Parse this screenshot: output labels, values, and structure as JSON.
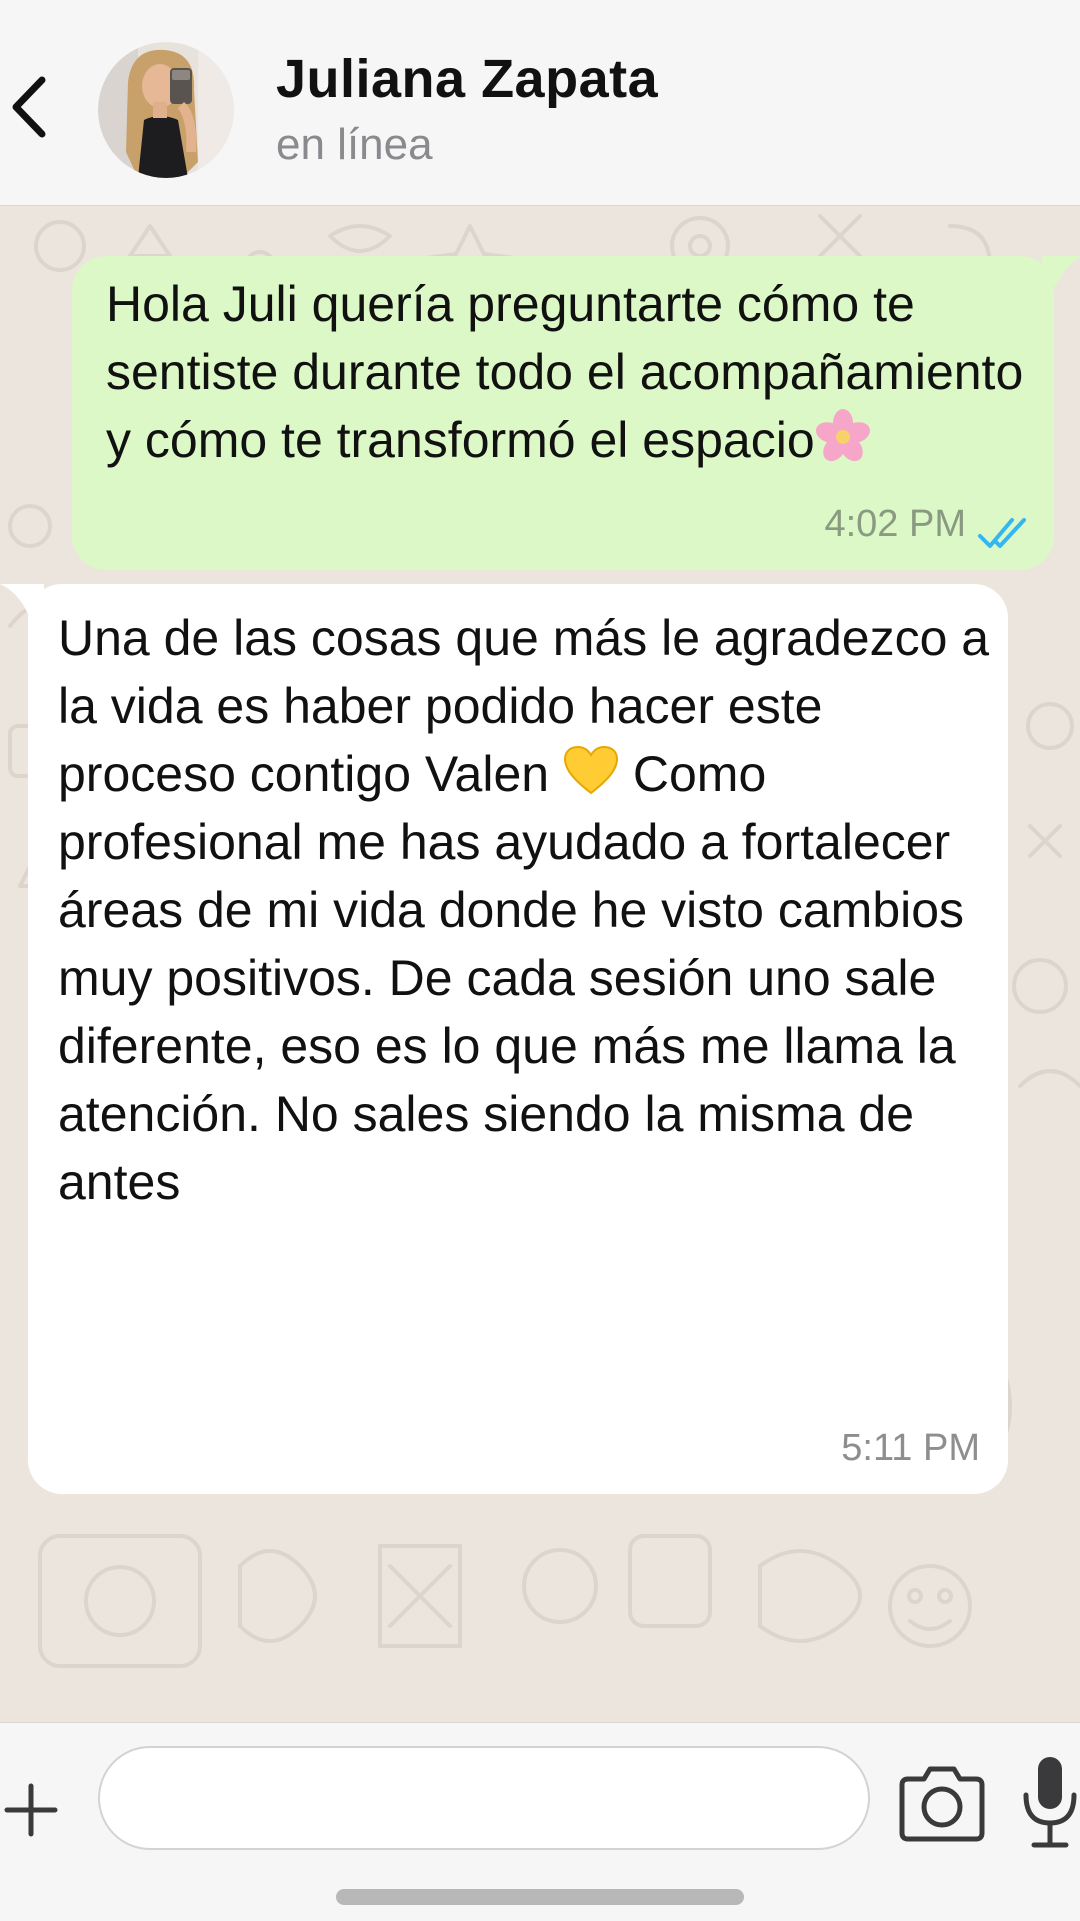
{
  "header": {
    "contact_name": "Juliana Zapata",
    "status": "en línea",
    "back_icon": "chevron-left-icon",
    "avatar_icon": "avatar"
  },
  "messages": [
    {
      "direction": "outgoing",
      "text": "Hola Juli quería preguntarte cómo te sentiste durante todo el acompañamiento y cómo te transformó el espacio",
      "emoji": "cherry-blossom-icon",
      "time": "4:02 PM",
      "status_icon": "double-check-icon"
    },
    {
      "direction": "incoming",
      "text_before_emoji": "Una de las cosas que más le agradezco a la vida es haber podido hacer este proceso contigo Valen",
      "emoji": "yellow-heart-icon",
      "text_after_emoji": "Como profesional me has ayudado a fortalecer áreas de mi vida donde he visto cambios muy positivos. De cada sesión uno sale diferente, eso es lo que más me llama la atención. No sales siendo la misma de antes",
      "time": "5:11 PM"
    }
  ],
  "input_bar": {
    "placeholder": "",
    "plus_icon": "plus-icon",
    "camera_icon": "camera-icon",
    "mic_icon": "microphone-icon"
  },
  "colors": {
    "outgoing_bubble": "#dcf8c6",
    "incoming_bubble": "#ffffff",
    "chat_background": "#ece5dd",
    "read_ticks": "#34b7f1"
  }
}
